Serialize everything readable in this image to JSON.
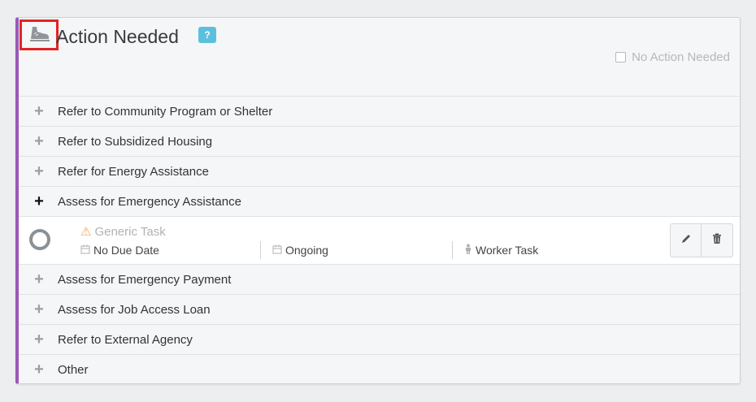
{
  "header": {
    "title": "Action Needed",
    "help_label": "?",
    "shoe_icon": "shoe-icon",
    "no_action_label": "No Action Needed"
  },
  "items_before": [
    {
      "label": "Refer to Community Program or Shelter"
    },
    {
      "label": "Refer to Subsidized Housing"
    },
    {
      "label": "Refer for Energy Assistance"
    },
    {
      "label": "Assess for Emergency Assistance"
    }
  ],
  "task": {
    "name": "Generic Task",
    "due": "No Due Date",
    "frequency": "Ongoing",
    "type": "Worker Task"
  },
  "items_after": [
    {
      "label": "Assess for Emergency Payment"
    },
    {
      "label": "Assess for Job Access Loan"
    },
    {
      "label": "Refer to External Agency"
    },
    {
      "label": "Other"
    }
  ],
  "colors": {
    "accent": "#9b59b6",
    "help": "#5bc0de",
    "warning": "#f0ad4e",
    "highlight": "#e02424"
  }
}
